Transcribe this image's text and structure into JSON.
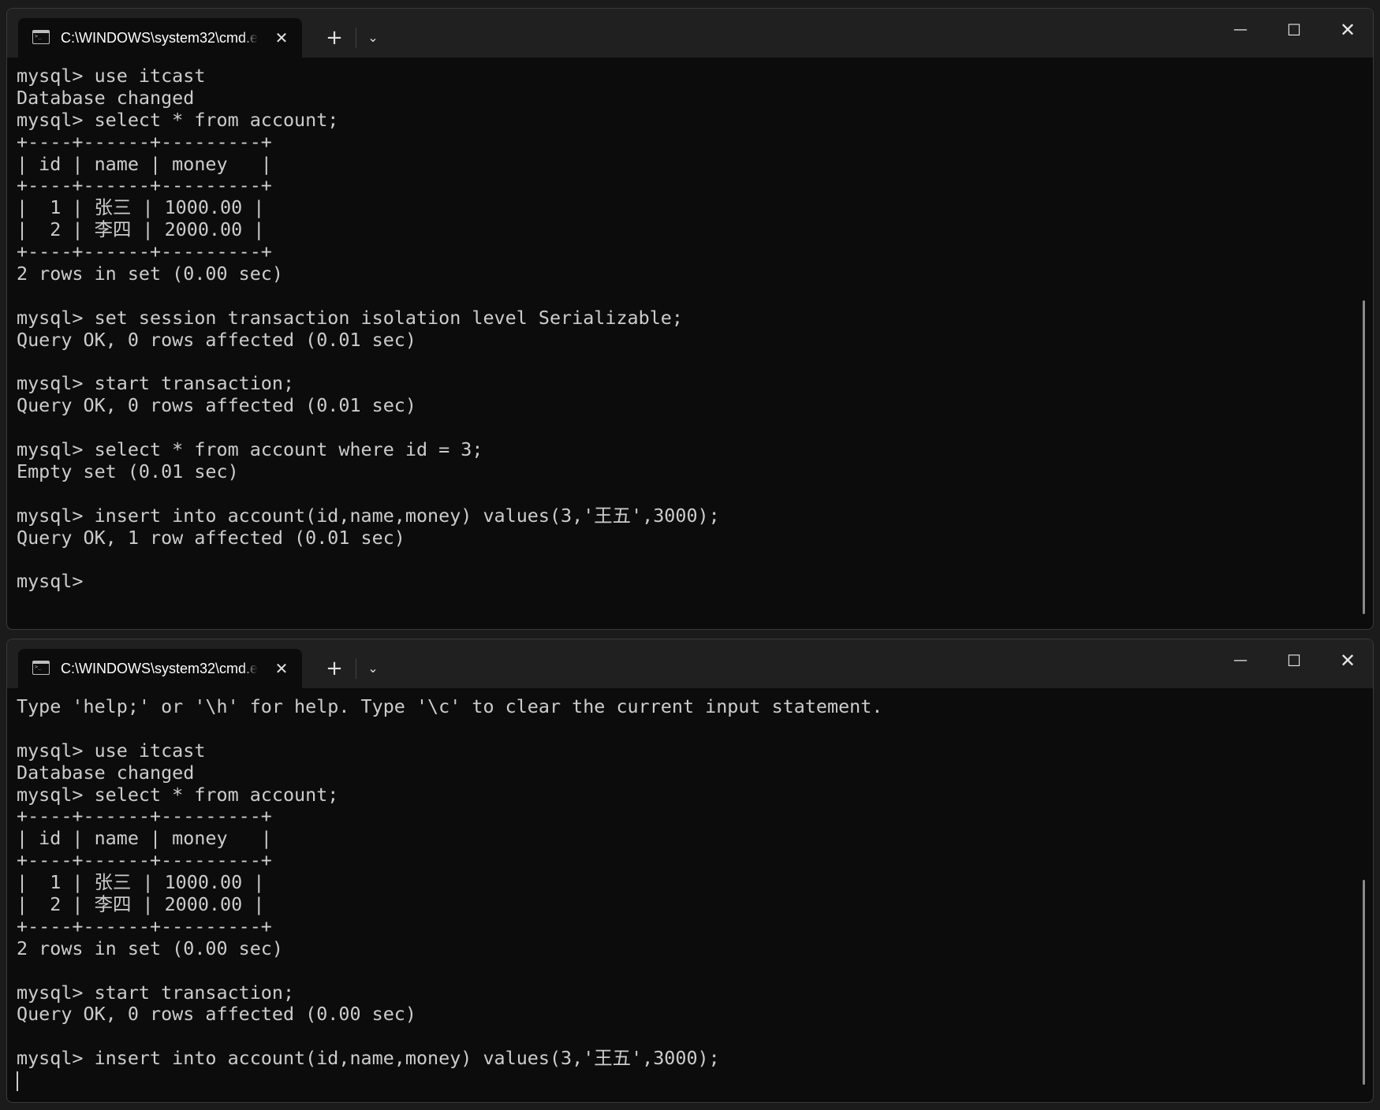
{
  "windows": [
    {
      "tab_title": "C:\\WINDOWS\\system32\\cmd.exe",
      "icons": {
        "tab": "terminal-icon",
        "close_tab": "close-icon",
        "new_tab": "plus-icon",
        "dropdown": "chevron-down-icon",
        "minimize": "minimize-icon",
        "maximize": "maximize-icon",
        "close_window": "close-icon"
      },
      "lines": [
        "mysql> use itcast",
        "Database changed",
        "mysql> select * from account;",
        "+----+------+---------+",
        "| id | name | money   |",
        "+----+------+---------+",
        "|  1 | 张三 | 1000.00 |",
        "|  2 | 李四 | 2000.00 |",
        "+----+------+---------+",
        "2 rows in set (0.00 sec)",
        "",
        "mysql> set session transaction isolation level Serializable;",
        "Query OK, 0 rows affected (0.01 sec)",
        "",
        "mysql> start transaction;",
        "Query OK, 0 rows affected (0.01 sec)",
        "",
        "mysql> select * from account where id = 3;",
        "Empty set (0.01 sec)",
        "",
        "mysql> insert into account(id,name,money) values(3,'王五',3000);",
        "Query OK, 1 row affected (0.01 sec)",
        "",
        "mysql>"
      ]
    },
    {
      "tab_title": "C:\\WINDOWS\\system32\\cmd.exe",
      "icons": {
        "tab": "terminal-icon",
        "close_tab": "close-icon",
        "new_tab": "plus-icon",
        "dropdown": "chevron-down-icon",
        "minimize": "minimize-icon",
        "maximize": "maximize-icon",
        "close_window": "close-icon"
      },
      "lines": [
        "Type 'help;' or '\\h' for help. Type '\\c' to clear the current input statement.",
        "",
        "mysql> use itcast",
        "Database changed",
        "mysql> select * from account;",
        "+----+------+---------+",
        "| id | name | money   |",
        "+----+------+---------+",
        "|  1 | 张三 | 1000.00 |",
        "|  2 | 李四 | 2000.00 |",
        "+----+------+---------+",
        "2 rows in set (0.00 sec)",
        "",
        "mysql> start transaction;",
        "Query OK, 0 rows affected (0.00 sec)",
        "",
        "mysql> insert into account(id,name,money) values(3,'王五',3000);"
      ]
    }
  ],
  "colors": {
    "terminal_bg": "#0c0c0c",
    "terminal_fg": "#cccccc",
    "titlebar_bg": "#202020"
  }
}
